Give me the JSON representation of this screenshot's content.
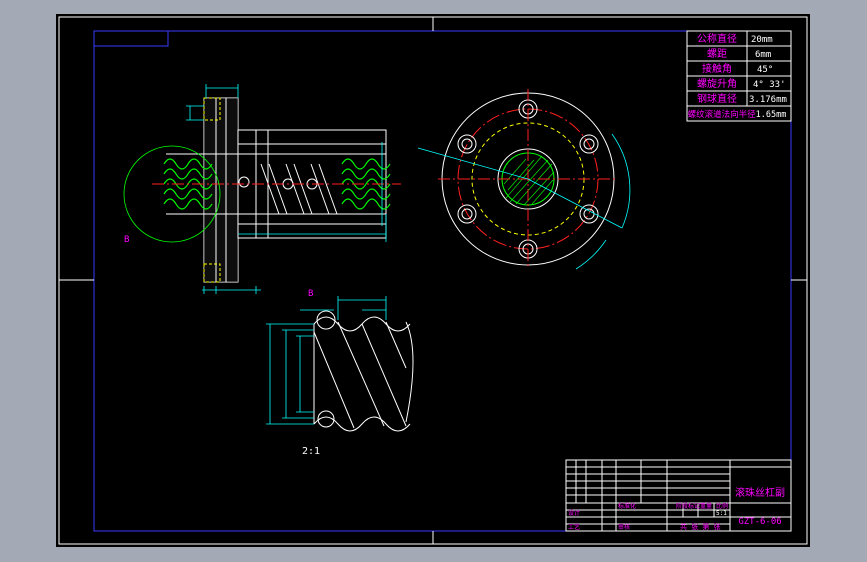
{
  "viewer": {
    "background_color": "#a3aab5",
    "sheet_color": "#000000"
  },
  "colors": {
    "frame": "#3a3aff",
    "section": "#00ff00",
    "table_text": "#ff00ff",
    "center_line": "#ff2020",
    "hidden_line": "#ffff00",
    "outline": "#ffffff",
    "dimension": "#00ffff"
  },
  "spec_table": {
    "rows": [
      {
        "label": "公称直径",
        "value": "20mm"
      },
      {
        "label": "螺距",
        "value": "6mm"
      },
      {
        "label": "接触角",
        "value": "45°"
      },
      {
        "label": "螺旋升角",
        "value": "4° 33'"
      },
      {
        "label": "钢球直径",
        "value": "3.176mm"
      },
      {
        "label": "螺纹滚道法向半径",
        "value": "1.65mm"
      }
    ]
  },
  "labels": {
    "detail_marker_main": "B",
    "detail_marker_detail": "B",
    "detail_scale": "2:1"
  },
  "title_block": {
    "drawing_name": "滚珠丝杠副",
    "drawing_number": "GZT-6-06",
    "scale": "5:1",
    "sheet_info": "共 张 第 张",
    "designer_label": "设计",
    "process_label": "工艺",
    "approve_label": "审核",
    "standard_label": "标准化",
    "marking_label": "阶段标记",
    "weight_label": "重量",
    "scale_label": "比例"
  }
}
